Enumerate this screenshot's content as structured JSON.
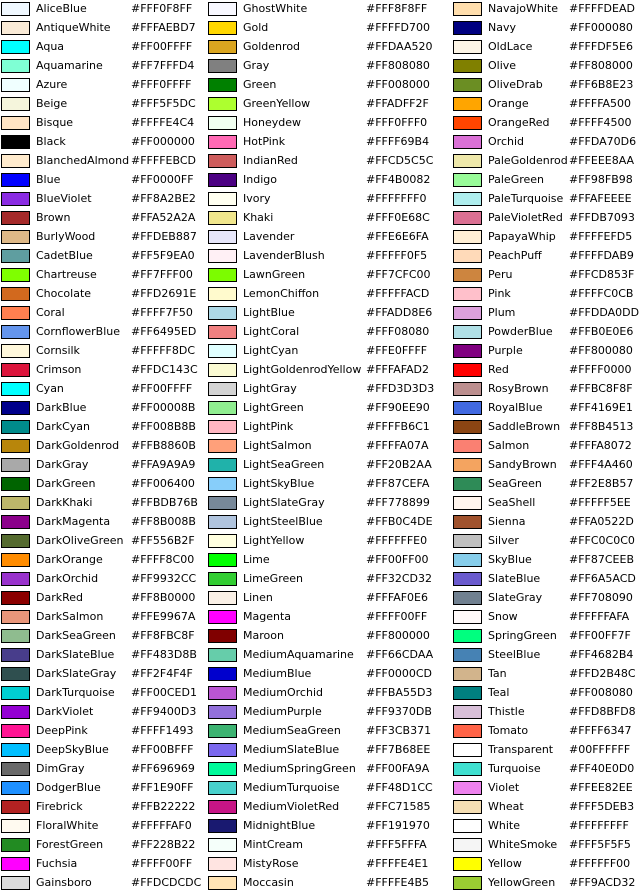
{
  "columns": [
    [
      {
        "name": "AliceBlue",
        "hex": "#FFF0F8FF",
        "color": "#F0F8FF"
      },
      {
        "name": "AntiqueWhite",
        "hex": "#FFFAEBD7",
        "color": "#FAEBD7"
      },
      {
        "name": "Aqua",
        "hex": "#FF00FFFF",
        "color": "#00FFFF"
      },
      {
        "name": "Aquamarine",
        "hex": "#FF7FFFD4",
        "color": "#7FFFD4"
      },
      {
        "name": "Azure",
        "hex": "#FFF0FFFF",
        "color": "#F0FFFF"
      },
      {
        "name": "Beige",
        "hex": "#FFF5F5DC",
        "color": "#F5F5DC"
      },
      {
        "name": "Bisque",
        "hex": "#FFFFE4C4",
        "color": "#FFE4C4"
      },
      {
        "name": "Black",
        "hex": "#FF000000",
        "color": "#000000"
      },
      {
        "name": "BlanchedAlmond",
        "hex": "#FFFFEBCD",
        "color": "#FFEBCD"
      },
      {
        "name": "Blue",
        "hex": "#FF0000FF",
        "color": "#0000FF"
      },
      {
        "name": "BlueViolet",
        "hex": "#FF8A2BE2",
        "color": "#8A2BE2"
      },
      {
        "name": "Brown",
        "hex": "#FFA52A2A",
        "color": "#A52A2A"
      },
      {
        "name": "BurlyWood",
        "hex": "#FFDEB887",
        "color": "#DEB887"
      },
      {
        "name": "CadetBlue",
        "hex": "#FF5F9EA0",
        "color": "#5F9EA0"
      },
      {
        "name": "Chartreuse",
        "hex": "#FF7FFF00",
        "color": "#7FFF00"
      },
      {
        "name": "Chocolate",
        "hex": "#FFD2691E",
        "color": "#D2691E"
      },
      {
        "name": "Coral",
        "hex": "#FFFF7F50",
        "color": "#FF7F50"
      },
      {
        "name": "CornflowerBlue",
        "hex": "#FF6495ED",
        "color": "#6495ED"
      },
      {
        "name": "Cornsilk",
        "hex": "#FFFFF8DC",
        "color": "#FFF8DC"
      },
      {
        "name": "Crimson",
        "hex": "#FFDC143C",
        "color": "#DC143C"
      },
      {
        "name": "Cyan",
        "hex": "#FF00FFFF",
        "color": "#00FFFF"
      },
      {
        "name": "DarkBlue",
        "hex": "#FF00008B",
        "color": "#00008B"
      },
      {
        "name": "DarkCyan",
        "hex": "#FF008B8B",
        "color": "#008B8B"
      },
      {
        "name": "DarkGoldenrod",
        "hex": "#FFB8860B",
        "color": "#B8860B"
      },
      {
        "name": "DarkGray",
        "hex": "#FFA9A9A9",
        "color": "#A9A9A9"
      },
      {
        "name": "DarkGreen",
        "hex": "#FF006400",
        "color": "#006400"
      },
      {
        "name": "DarkKhaki",
        "hex": "#FFBDB76B",
        "color": "#BDB76B"
      },
      {
        "name": "DarkMagenta",
        "hex": "#FF8B008B",
        "color": "#8B008B"
      },
      {
        "name": "DarkOliveGreen",
        "hex": "#FF556B2F",
        "color": "#556B2F"
      },
      {
        "name": "DarkOrange",
        "hex": "#FFFF8C00",
        "color": "#FF8C00"
      },
      {
        "name": "DarkOrchid",
        "hex": "#FF9932CC",
        "color": "#9932CC"
      },
      {
        "name": "DarkRed",
        "hex": "#FF8B0000",
        "color": "#8B0000"
      },
      {
        "name": "DarkSalmon",
        "hex": "#FFE9967A",
        "color": "#E9967A"
      },
      {
        "name": "DarkSeaGreen",
        "hex": "#FF8FBC8F",
        "color": "#8FBC8F"
      },
      {
        "name": "DarkSlateBlue",
        "hex": "#FF483D8B",
        "color": "#483D8B"
      },
      {
        "name": "DarkSlateGray",
        "hex": "#FF2F4F4F",
        "color": "#2F4F4F"
      },
      {
        "name": "DarkTurquoise",
        "hex": "#FF00CED1",
        "color": "#00CED1"
      },
      {
        "name": "DarkViolet",
        "hex": "#FF9400D3",
        "color": "#9400D3"
      },
      {
        "name": "DeepPink",
        "hex": "#FFFF1493",
        "color": "#FF1493"
      },
      {
        "name": "DeepSkyBlue",
        "hex": "#FF00BFFF",
        "color": "#00BFFF"
      },
      {
        "name": "DimGray",
        "hex": "#FF696969",
        "color": "#696969"
      },
      {
        "name": "DodgerBlue",
        "hex": "#FF1E90FF",
        "color": "#1E90FF"
      },
      {
        "name": "Firebrick",
        "hex": "#FFB22222",
        "color": "#B22222"
      },
      {
        "name": "FloralWhite",
        "hex": "#FFFFFAF0",
        "color": "#FFFAF0"
      },
      {
        "name": "ForestGreen",
        "hex": "#FF228B22",
        "color": "#228B22"
      },
      {
        "name": "Fuchsia",
        "hex": "#FFFF00FF",
        "color": "#FF00FF"
      },
      {
        "name": "Gainsboro",
        "hex": "#FFDCDCDC",
        "color": "#DCDCDC"
      }
    ],
    [
      {
        "name": "GhostWhite",
        "hex": "#FFF8F8FF",
        "color": "#F8F8FF"
      },
      {
        "name": "Gold",
        "hex": "#FFFFD700",
        "color": "#FFD700"
      },
      {
        "name": "Goldenrod",
        "hex": "#FFDAA520",
        "color": "#DAA520"
      },
      {
        "name": "Gray",
        "hex": "#FF808080",
        "color": "#808080"
      },
      {
        "name": "Green",
        "hex": "#FF008000",
        "color": "#008000"
      },
      {
        "name": "GreenYellow",
        "hex": "#FFADFF2F",
        "color": "#ADFF2F"
      },
      {
        "name": "Honeydew",
        "hex": "#FFF0FFF0",
        "color": "#F0FFF0"
      },
      {
        "name": "HotPink",
        "hex": "#FFFF69B4",
        "color": "#FF69B4"
      },
      {
        "name": "IndianRed",
        "hex": "#FFCD5C5C",
        "color": "#CD5C5C"
      },
      {
        "name": "Indigo",
        "hex": "#FF4B0082",
        "color": "#4B0082"
      },
      {
        "name": "Ivory",
        "hex": "#FFFFFFF0",
        "color": "#FFFFF0"
      },
      {
        "name": "Khaki",
        "hex": "#FFF0E68C",
        "color": "#F0E68C"
      },
      {
        "name": "Lavender",
        "hex": "#FFE6E6FA",
        "color": "#E6E6FA"
      },
      {
        "name": "LavenderBlush",
        "hex": "#FFFFF0F5",
        "color": "#FFF0F5"
      },
      {
        "name": "LawnGreen",
        "hex": "#FF7CFC00",
        "color": "#7CFC00"
      },
      {
        "name": "LemonChiffon",
        "hex": "#FFFFFACD",
        "color": "#FFFACD"
      },
      {
        "name": "LightBlue",
        "hex": "#FFADD8E6",
        "color": "#ADD8E6"
      },
      {
        "name": "LightCoral",
        "hex": "#FFF08080",
        "color": "#F08080"
      },
      {
        "name": "LightCyan",
        "hex": "#FFE0FFFF",
        "color": "#E0FFFF"
      },
      {
        "name": "LightGoldenrodYellow",
        "hex": "#FFFAFAD2",
        "color": "#FAFAD2"
      },
      {
        "name": "LightGray",
        "hex": "#FFD3D3D3",
        "color": "#D3D3D3"
      },
      {
        "name": "LightGreen",
        "hex": "#FF90EE90",
        "color": "#90EE90"
      },
      {
        "name": "LightPink",
        "hex": "#FFFFB6C1",
        "color": "#FFB6C1"
      },
      {
        "name": "LightSalmon",
        "hex": "#FFFFA07A",
        "color": "#FFA07A"
      },
      {
        "name": "LightSeaGreen",
        "hex": "#FF20B2AA",
        "color": "#20B2AA"
      },
      {
        "name": "LightSkyBlue",
        "hex": "#FF87CEFA",
        "color": "#87CEFA"
      },
      {
        "name": "LightSlateGray",
        "hex": "#FF778899",
        "color": "#778899"
      },
      {
        "name": "LightSteelBlue",
        "hex": "#FFB0C4DE",
        "color": "#B0C4DE"
      },
      {
        "name": "LightYellow",
        "hex": "#FFFFFFE0",
        "color": "#FFFFE0"
      },
      {
        "name": "Lime",
        "hex": "#FF00FF00",
        "color": "#00FF00"
      },
      {
        "name": "LimeGreen",
        "hex": "#FF32CD32",
        "color": "#32CD32"
      },
      {
        "name": "Linen",
        "hex": "#FFFAF0E6",
        "color": "#FAF0E6"
      },
      {
        "name": "Magenta",
        "hex": "#FFFF00FF",
        "color": "#FF00FF"
      },
      {
        "name": "Maroon",
        "hex": "#FF800000",
        "color": "#800000"
      },
      {
        "name": "MediumAquamarine",
        "hex": "#FF66CDAA",
        "color": "#66CDAA"
      },
      {
        "name": "MediumBlue",
        "hex": "#FF0000CD",
        "color": "#0000CD"
      },
      {
        "name": "MediumOrchid",
        "hex": "#FFBA55D3",
        "color": "#BA55D3"
      },
      {
        "name": "MediumPurple",
        "hex": "#FF9370DB",
        "color": "#9370DB"
      },
      {
        "name": "MediumSeaGreen",
        "hex": "#FF3CB371",
        "color": "#3CB371"
      },
      {
        "name": "MediumSlateBlue",
        "hex": "#FF7B68EE",
        "color": "#7B68EE"
      },
      {
        "name": "MediumSpringGreen",
        "hex": "#FF00FA9A",
        "color": "#00FA9A"
      },
      {
        "name": "MediumTurquoise",
        "hex": "#FF48D1CC",
        "color": "#48D1CC"
      },
      {
        "name": "MediumVioletRed",
        "hex": "#FFC71585",
        "color": "#C71585"
      },
      {
        "name": "MidnightBlue",
        "hex": "#FF191970",
        "color": "#191970"
      },
      {
        "name": "MintCream",
        "hex": "#FFF5FFFA",
        "color": "#F5FFFA"
      },
      {
        "name": "MistyRose",
        "hex": "#FFFFE4E1",
        "color": "#FFE4E1"
      },
      {
        "name": "Moccasin",
        "hex": "#FFFFE4B5",
        "color": "#FFE4B5"
      }
    ],
    [
      {
        "name": "NavajoWhite",
        "hex": "#FFFFDEAD",
        "color": "#FFDEAD"
      },
      {
        "name": "Navy",
        "hex": "#FF000080",
        "color": "#000080"
      },
      {
        "name": "OldLace",
        "hex": "#FFFDF5E6",
        "color": "#FDF5E6"
      },
      {
        "name": "Olive",
        "hex": "#FF808000",
        "color": "#808000"
      },
      {
        "name": "OliveDrab",
        "hex": "#FF6B8E23",
        "color": "#6B8E23"
      },
      {
        "name": "Orange",
        "hex": "#FFFFA500",
        "color": "#FFA500"
      },
      {
        "name": "OrangeRed",
        "hex": "#FFFF4500",
        "color": "#FF4500"
      },
      {
        "name": "Orchid",
        "hex": "#FFDA70D6",
        "color": "#DA70D6"
      },
      {
        "name": "PaleGoldenrod",
        "hex": "#FFEEE8AA",
        "color": "#EEE8AA"
      },
      {
        "name": "PaleGreen",
        "hex": "#FF98FB98",
        "color": "#98FB98"
      },
      {
        "name": "PaleTurquoise",
        "hex": "#FFAFEEEE",
        "color": "#AFEEEE"
      },
      {
        "name": "PaleVioletRed",
        "hex": "#FFDB7093",
        "color": "#DB7093"
      },
      {
        "name": "PapayaWhip",
        "hex": "#FFFFEFD5",
        "color": "#FFEFD5"
      },
      {
        "name": "PeachPuff",
        "hex": "#FFFFDAB9",
        "color": "#FFDAB9"
      },
      {
        "name": "Peru",
        "hex": "#FFCD853F",
        "color": "#CD853F"
      },
      {
        "name": "Pink",
        "hex": "#FFFFC0CB",
        "color": "#FFC0CB"
      },
      {
        "name": "Plum",
        "hex": "#FFDDA0DD",
        "color": "#DDA0DD"
      },
      {
        "name": "PowderBlue",
        "hex": "#FFB0E0E6",
        "color": "#B0E0E6"
      },
      {
        "name": "Purple",
        "hex": "#FF800080",
        "color": "#800080"
      },
      {
        "name": "Red",
        "hex": "#FFFF0000",
        "color": "#FF0000"
      },
      {
        "name": "RosyBrown",
        "hex": "#FFBC8F8F",
        "color": "#BC8F8F"
      },
      {
        "name": "RoyalBlue",
        "hex": "#FF4169E1",
        "color": "#4169E1"
      },
      {
        "name": "SaddleBrown",
        "hex": "#FF8B4513",
        "color": "#8B4513"
      },
      {
        "name": "Salmon",
        "hex": "#FFFA8072",
        "color": "#FA8072"
      },
      {
        "name": "SandyBrown",
        "hex": "#FFF4A460",
        "color": "#F4A460"
      },
      {
        "name": "SeaGreen",
        "hex": "#FF2E8B57",
        "color": "#2E8B57"
      },
      {
        "name": "SeaShell",
        "hex": "#FFFFF5EE",
        "color": "#FFF5EE"
      },
      {
        "name": "Sienna",
        "hex": "#FFA0522D",
        "color": "#A0522D"
      },
      {
        "name": "Silver",
        "hex": "#FFC0C0C0",
        "color": "#C0C0C0"
      },
      {
        "name": "SkyBlue",
        "hex": "#FF87CEEB",
        "color": "#87CEEB"
      },
      {
        "name": "SlateBlue",
        "hex": "#FF6A5ACD",
        "color": "#6A5ACD"
      },
      {
        "name": "SlateGray",
        "hex": "#FF708090",
        "color": "#708090"
      },
      {
        "name": "Snow",
        "hex": "#FFFFFAFA",
        "color": "#FFFAFA"
      },
      {
        "name": "SpringGreen",
        "hex": "#FF00FF7F",
        "color": "#00FF7F"
      },
      {
        "name": "SteelBlue",
        "hex": "#FF4682B4",
        "color": "#4682B4"
      },
      {
        "name": "Tan",
        "hex": "#FFD2B48C",
        "color": "#D2B48C"
      },
      {
        "name": "Teal",
        "hex": "#FF008080",
        "color": "#008080"
      },
      {
        "name": "Thistle",
        "hex": "#FFD8BFD8",
        "color": "#D8BFD8"
      },
      {
        "name": "Tomato",
        "hex": "#FFFF6347",
        "color": "#FF6347"
      },
      {
        "name": "Transparent",
        "hex": "#00FFFFFF",
        "color": "#FFFFFF"
      },
      {
        "name": "Turquoise",
        "hex": "#FF40E0D0",
        "color": "#40E0D0"
      },
      {
        "name": "Violet",
        "hex": "#FFEE82EE",
        "color": "#EE82EE"
      },
      {
        "name": "Wheat",
        "hex": "#FFF5DEB3",
        "color": "#F5DEB3"
      },
      {
        "name": "White",
        "hex": "#FFFFFFFF",
        "color": "#FFFFFF"
      },
      {
        "name": "WhiteSmoke",
        "hex": "#FFF5F5F5",
        "color": "#F5F5F5"
      },
      {
        "name": "Yellow",
        "hex": "#FFFFFF00",
        "color": "#FFFF00"
      },
      {
        "name": "YellowGreen",
        "hex": "#FF9ACD32",
        "color": "#9ACD32"
      }
    ]
  ]
}
